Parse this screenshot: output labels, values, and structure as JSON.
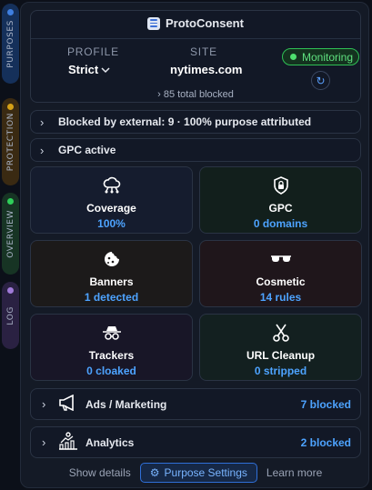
{
  "tabs": [
    {
      "label": "PURPOSES",
      "dot": "#3f7fe0"
    },
    {
      "label": "PROTECTION",
      "dot": "#d4a017"
    },
    {
      "label": "OVERVIEW",
      "dot": "#2fcf5a"
    },
    {
      "label": "LOG",
      "dot": "#a07ad8"
    }
  ],
  "header": {
    "title": "ProtoConsent",
    "profile_label": "PROFILE",
    "profile_value": "Strict",
    "site_label": "SITE",
    "site_value": "nytimes.com",
    "status": "Monitoring",
    "total": "85 total blocked"
  },
  "rows": {
    "external": "Blocked by external: 9 · 100% purpose attributed",
    "gpc": "GPC active"
  },
  "cards": [
    {
      "title": "Coverage",
      "value": "100%",
      "icon": "cloud-network-icon"
    },
    {
      "title": "GPC",
      "value": "0 domains",
      "icon": "shield-lock-icon"
    },
    {
      "title": "Banners",
      "value": "1 detected",
      "icon": "cookie-icon"
    },
    {
      "title": "Cosmetic",
      "value": "14 rules",
      "icon": "sunglasses-icon"
    },
    {
      "title": "Trackers",
      "value": "0 cloaked",
      "icon": "spy-icon"
    },
    {
      "title": "URL Cleanup",
      "value": "0 stripped",
      "icon": "scissors-icon"
    }
  ],
  "categories": [
    {
      "label": "Ads / Marketing",
      "count": "7 blocked",
      "icon": "megaphone-icon"
    },
    {
      "label": "Analytics",
      "count": "2 blocked",
      "icon": "analytics-icon"
    }
  ],
  "footer": {
    "show_details": "Show details",
    "purpose_settings": "Purpose Settings",
    "learn_more": "Learn more"
  },
  "colors": {
    "accent": "#4da3ff",
    "monitoring": "#5fe07f"
  }
}
